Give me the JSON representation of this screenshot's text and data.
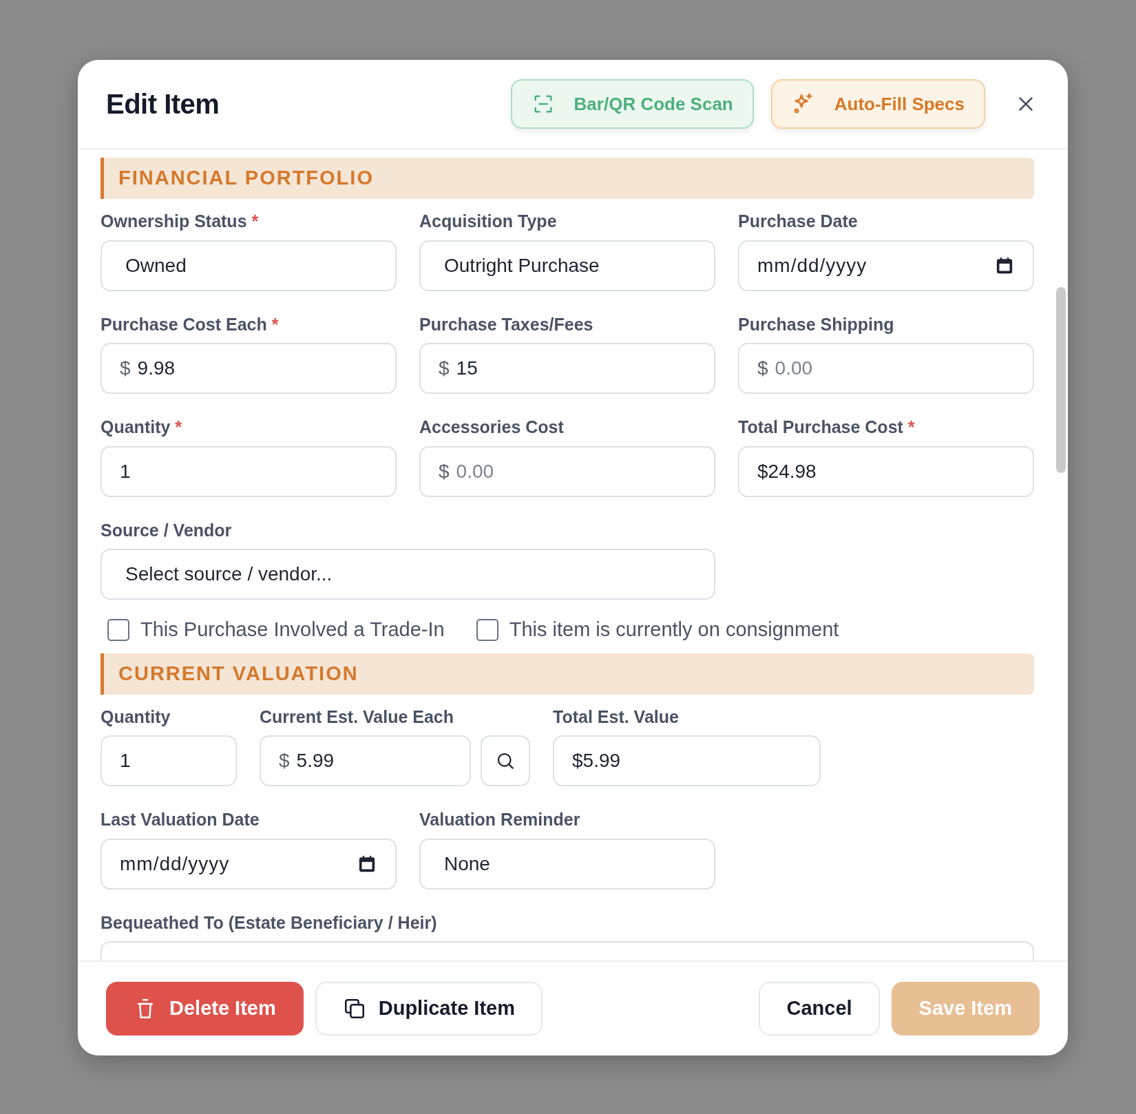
{
  "dialog": {
    "title": "Edit Item",
    "header_buttons": [
      {
        "label": "Bar/QR Code Scan",
        "kind": "scan"
      },
      {
        "label": "Auto-Fill Specs",
        "kind": "autofill"
      }
    ],
    "sections": [
      {
        "title": "FINANCIAL PORTFOLIO",
        "rows": [
          {
            "kind": "three",
            "fields": [
              {
                "label": "Ownership Status",
                "required_mark": "*",
                "kind": "select",
                "value": "Owned"
              },
              {
                "label": "Acquisition Type",
                "kind": "select",
                "value": "Outright Purchase"
              },
              {
                "label": "Purchase Date",
                "kind": "date",
                "placeholder": "mm/dd/yyyy"
              }
            ]
          },
          {
            "kind": "three",
            "fields": [
              {
                "label": "Purchase Cost Each",
                "required_mark": "*",
                "kind": "money",
                "prefix": "$",
                "value": "9.98"
              },
              {
                "label": "Purchase Taxes/Fees",
                "kind": "money",
                "prefix": "$",
                "value": "15"
              },
              {
                "label": "Purchase Shipping",
                "kind": "money",
                "prefix": "$",
                "placeholder": "0.00"
              }
            ]
          },
          {
            "kind": "three",
            "fields": [
              {
                "label": "Quantity",
                "required_mark": "*",
                "kind": "text",
                "value": "1"
              },
              {
                "label": "Accessories Cost",
                "kind": "money",
                "prefix": "$",
                "placeholder": "0.00"
              },
              {
                "label": "Total Purchase Cost",
                "required_mark": "*",
                "kind": "text",
                "value": "$24.98"
              }
            ]
          },
          {
            "kind": "wide",
            "fields": [
              {
                "label": "Source / Vendor",
                "kind": "select",
                "value": "Select source / vendor..."
              }
            ]
          },
          {
            "kind": "checks",
            "fields": [
              {
                "label": "This Purchase Involved a Trade-In",
                "kind": "checkbox",
                "checked": false
              },
              {
                "label": "This item is currently on consignment",
                "kind": "checkbox",
                "checked": false
              }
            ]
          }
        ]
      },
      {
        "title": "CURRENT VALUATION",
        "rows": [
          {
            "kind": "valuation",
            "fields": [
              {
                "label": "Quantity",
                "kind": "text",
                "value": "1"
              },
              {
                "label": "Current Est. Value Each",
                "kind": "money",
                "prefix": "$",
                "value": "5.99"
              },
              {
                "kind": "search"
              },
              {
                "label": "Total Est. Value",
                "kind": "text",
                "value": "$5.99"
              }
            ]
          },
          {
            "kind": "three",
            "fields": [
              {
                "label": "Last Valuation Date",
                "kind": "date",
                "placeholder": "mm/dd/yyyy"
              },
              {
                "label": "Valuation Reminder",
                "kind": "select",
                "value": "None"
              }
            ]
          },
          {
            "kind": "full",
            "fields": [
              {
                "label": "Bequeathed To (Estate Beneficiary / Heir)",
                "kind": "text"
              }
            ]
          }
        ]
      }
    ],
    "footer_buttons": [
      {
        "label": "Delete Item",
        "kind": "delete",
        "disabled": false
      },
      {
        "label": "Duplicate Item",
        "kind": "duplicate",
        "disabled": false
      },
      {
        "label": "Cancel",
        "kind": "cancel",
        "disabled": false
      },
      {
        "label": "Save Item",
        "kind": "save",
        "disabled": true
      }
    ]
  }
}
